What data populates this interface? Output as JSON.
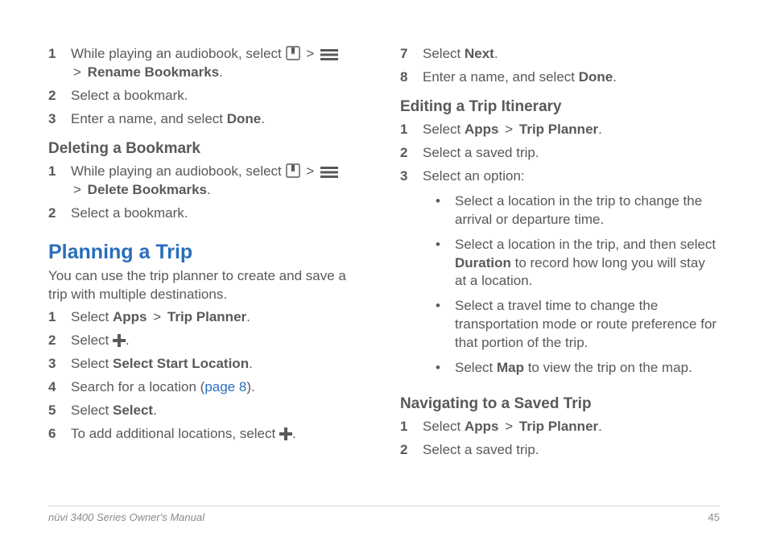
{
  "left": {
    "rename": {
      "items": [
        {
          "num": "1",
          "pre": "While playing an audiobook, select ",
          "gt1": ">",
          "gt2": ">",
          "tail": "Rename Bookmarks",
          "after": "."
        },
        {
          "num": "2",
          "text": "Select a bookmark."
        },
        {
          "num": "3",
          "pre": "Enter a name, and select ",
          "bold": "Done",
          "after": "."
        }
      ]
    },
    "deleteHeading": "Deleting a Bookmark",
    "delete": {
      "items": [
        {
          "num": "1",
          "pre": "While playing an audiobook, select ",
          "gt1": ">",
          "gt2": ">",
          "tail": "Delete Bookmarks",
          "after": "."
        },
        {
          "num": "2",
          "text": "Select a bookmark."
        }
      ]
    },
    "planHeading": "Planning a Trip",
    "planIntro": "You can use the trip planner to create and save a trip with multiple destinations.",
    "plan": {
      "items": [
        {
          "num": "1",
          "pre": "Select ",
          "b1": "Apps",
          "gt": ">",
          "b2": "Trip Planner",
          "after": "."
        },
        {
          "num": "2",
          "pre": "Select ",
          "after": "."
        },
        {
          "num": "3",
          "pre": "Select ",
          "bold": "Select Start Location",
          "after": "."
        },
        {
          "num": "4",
          "pre": "Search for a location (",
          "link": "page 8",
          "after": ")."
        },
        {
          "num": "5",
          "pre": "Select ",
          "bold": "Select",
          "after": "."
        },
        {
          "num": "6",
          "pre": "To add additional locations, select ",
          "after": "."
        }
      ]
    }
  },
  "right": {
    "cont": {
      "items": [
        {
          "num": "7",
          "pre": "Select ",
          "bold": "Next",
          "after": "."
        },
        {
          "num": "8",
          "pre": "Enter a name, and select ",
          "bold": "Done",
          "after": "."
        }
      ]
    },
    "editHeading": "Editing a Trip Itinerary",
    "edit": {
      "items": [
        {
          "num": "1",
          "pre": "Select ",
          "b1": "Apps",
          "gt": ">",
          "b2": "Trip Planner",
          "after": "."
        },
        {
          "num": "2",
          "text": "Select a saved trip."
        },
        {
          "num": "3",
          "text": "Select an option:"
        }
      ],
      "bullets": [
        {
          "text": "Select a location in the trip to change the arrival or departure time."
        },
        {
          "pre": "Select a location in the trip, and then select ",
          "bold": "Duration",
          "after": " to record how long you will stay at a location."
        },
        {
          "text": "Select a travel time to change the transportation mode or route preference for that portion of the trip."
        },
        {
          "pre": "Select ",
          "bold": "Map",
          "after": " to view the trip on the map."
        }
      ]
    },
    "navHeading": "Navigating to a Saved Trip",
    "nav": {
      "items": [
        {
          "num": "1",
          "pre": "Select ",
          "b1": "Apps",
          "gt": ">",
          "b2": "Trip Planner",
          "after": "."
        },
        {
          "num": "2",
          "text": "Select a saved trip."
        }
      ]
    }
  },
  "footer": {
    "title": "nüvi 3400 Series Owner's Manual",
    "page": "45"
  }
}
